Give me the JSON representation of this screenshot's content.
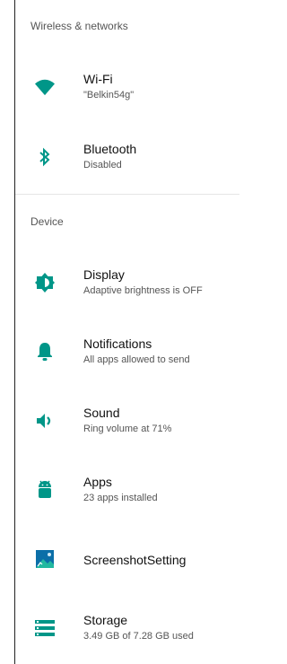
{
  "colors": {
    "accent": "#009688"
  },
  "sections": {
    "wireless": {
      "title": "Wireless & networks"
    },
    "device": {
      "title": "Device"
    }
  },
  "items": {
    "wifi": {
      "icon": "wifi-icon",
      "title": "Wi-Fi",
      "summary": "\"Belkin54g\""
    },
    "bluetooth": {
      "icon": "bluetooth-icon",
      "title": "Bluetooth",
      "summary": "Disabled"
    },
    "display": {
      "icon": "brightness-icon",
      "title": "Display",
      "summary": "Adaptive brightness is OFF"
    },
    "notifications": {
      "icon": "bell-icon",
      "title": "Notifications",
      "summary": "All apps allowed to send"
    },
    "sound": {
      "icon": "volume-icon",
      "title": "Sound",
      "summary": "Ring volume at 71%"
    },
    "apps": {
      "icon": "android-icon",
      "title": "Apps",
      "summary": "23 apps installed"
    },
    "screenshot": {
      "icon": "image-icon",
      "title": "ScreenshotSetting"
    },
    "storage": {
      "icon": "storage-icon",
      "title": "Storage",
      "summary": "3.49 GB of 7.28 GB used"
    }
  }
}
